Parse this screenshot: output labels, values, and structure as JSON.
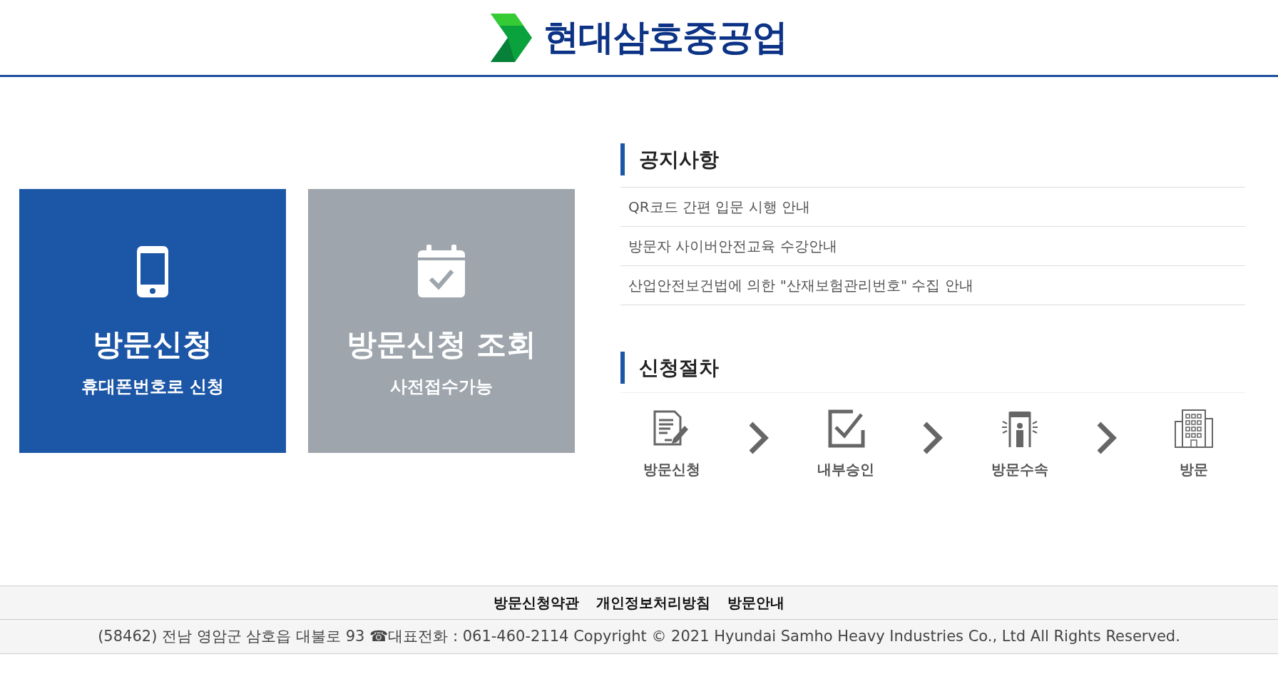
{
  "header": {
    "logo_text": "현대삼호중공업"
  },
  "tiles": [
    {
      "kind": "phone",
      "title": "방문신청",
      "subtitle": "휴대폰번호로 신청",
      "color": "#1c56a6"
    },
    {
      "kind": "calendar",
      "title": "방문신청 조회",
      "subtitle": "사전접수가능",
      "color": "#9ea5ac"
    }
  ],
  "notices": {
    "title": "공지사항",
    "items": [
      "QR코드 간편 입문 시행 안내",
      "방문자 사이버안전교육 수강안내",
      "산업안전보건법에 의한 \"산재보험관리번호\" 수집 안내"
    ]
  },
  "procedure": {
    "title": "신청절차",
    "steps": [
      {
        "kind": "form",
        "label": "방문신청"
      },
      {
        "kind": "check",
        "label": "내부승인"
      },
      {
        "kind": "gate",
        "label": "방문수속"
      },
      {
        "kind": "building",
        "label": "방문"
      }
    ]
  },
  "footer": {
    "links": [
      "방문신청약관",
      "개인정보처리방침",
      "방문안내"
    ],
    "address": "(58462) 전남 영암군 삼호읍 대불로 93 ☎대표전화 : 061-460-2114 Copyright © 2021 Hyundai Samho Heavy Industries Co., Ltd All Rights Reserved."
  }
}
